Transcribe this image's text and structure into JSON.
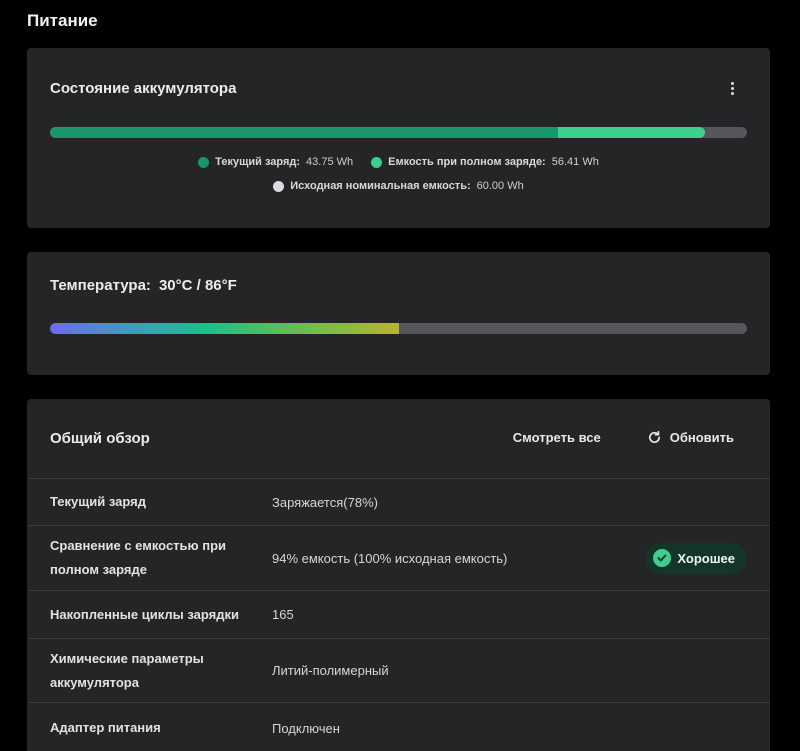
{
  "page": {
    "title": "Питание"
  },
  "battery": {
    "title": "Состояние аккумулятора",
    "current_fraction": 0.7292,
    "full_fraction": 0.9402,
    "legend": [
      {
        "label": "Текущий заряд:",
        "value": "43.75 Wh",
        "color": "#17976b"
      },
      {
        "label": "Емкость при полном заряде:",
        "value": "56.41 Wh",
        "color": "#3ccf8e"
      },
      {
        "label": "Исходная номинальная емкость:",
        "value": "60.00 Wh",
        "color": "#d9dce6"
      }
    ],
    "colors": {
      "current": "#17976b",
      "full": "#3ccf8e",
      "track": "#56565c"
    }
  },
  "temperature": {
    "label": "Температура:",
    "value": "30°C / 86°F",
    "fraction": 0.5
  },
  "overview": {
    "title": "Общий обзор",
    "view_all_label": "Смотреть все",
    "refresh_label": "Обновить",
    "rows": [
      {
        "label": "Текущий заряд",
        "value": "Заряжается(78%)"
      },
      {
        "label": "Сравнение с емкостью при полном заряде",
        "value": "94% емкость (100% исходная емкость)",
        "badge": "Хорошее"
      },
      {
        "label": "Накопленные циклы зарядки",
        "value": "165"
      },
      {
        "label": "Химические параметры аккумулятора",
        "value": "Литий-полимерный"
      },
      {
        "label": "Адаптер питания",
        "value": "Подключен"
      }
    ]
  },
  "icons": {
    "more": "more-vertical-icon",
    "refresh": "refresh-icon",
    "badge": "check-circle-icon"
  }
}
